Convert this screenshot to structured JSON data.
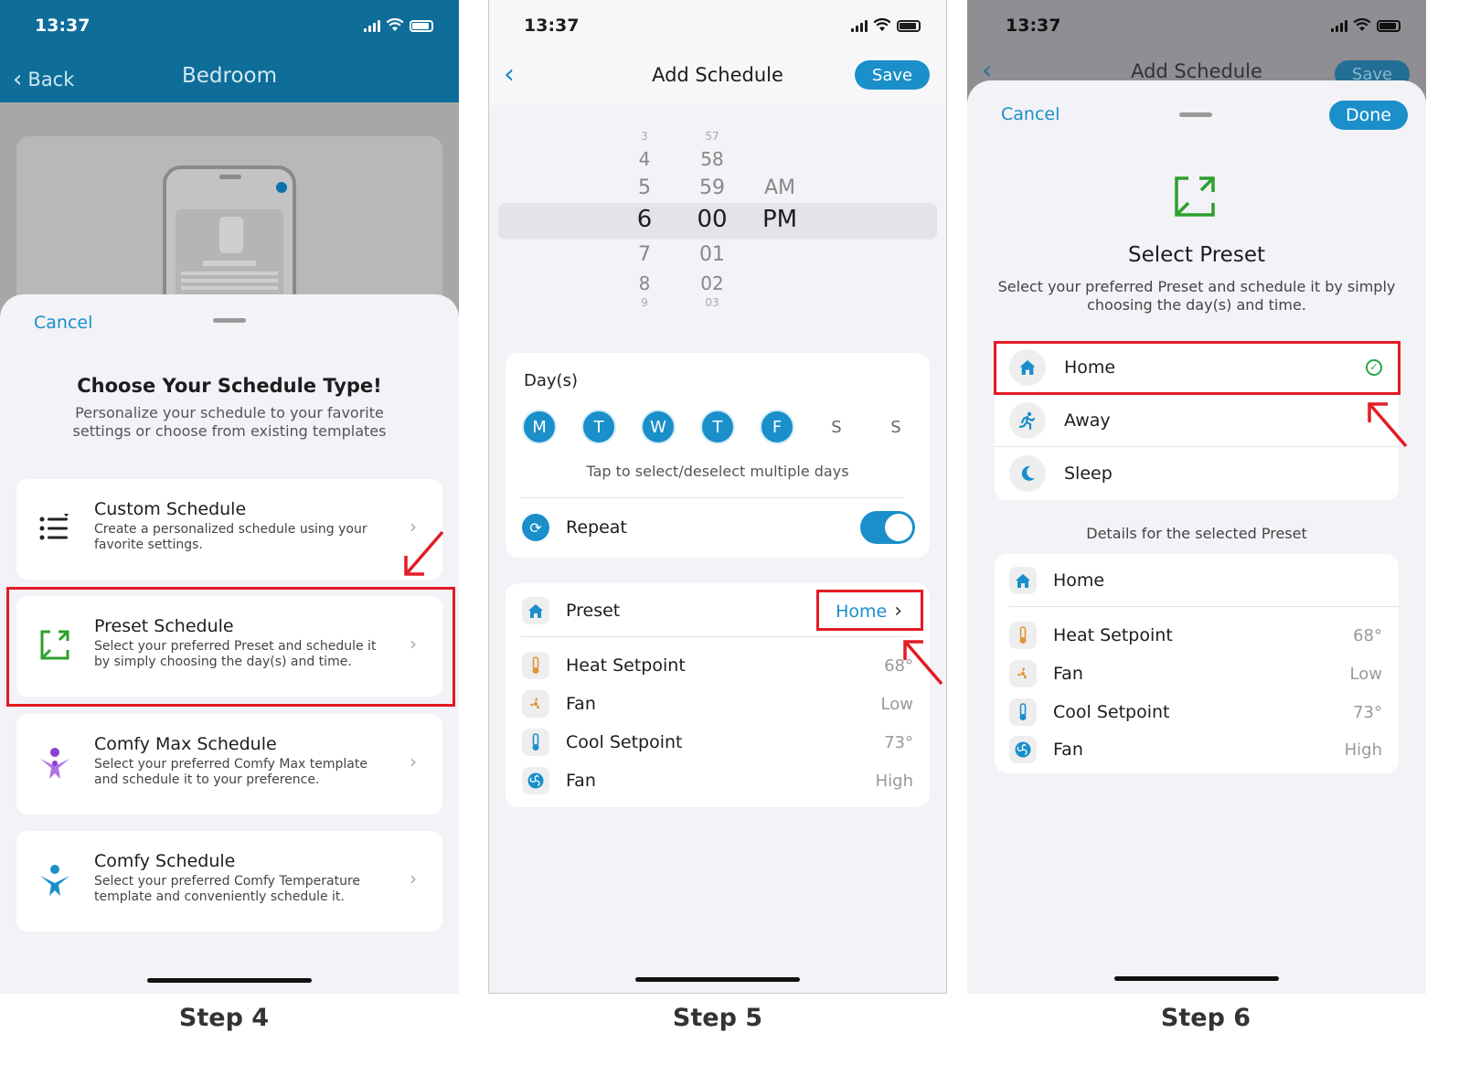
{
  "status": {
    "time": "13:37"
  },
  "step4": {
    "nav": {
      "back_label": "Back",
      "title": "Bedroom"
    },
    "sheet": {
      "cancel_label": "Cancel",
      "heading": "Choose Your Schedule Type!",
      "subheading": "Personalize your schedule to your favorite settings or choose from existing templates",
      "options": [
        {
          "title": "Custom Schedule",
          "desc": "Create a personalized schedule using your favorite settings.",
          "icon": "list-sliders-icon"
        },
        {
          "title": "Preset Schedule",
          "desc": "Select your preferred Preset and schedule it by simply choosing the day(s) and time.",
          "icon": "preset-expand-icon"
        },
        {
          "title": "Comfy Max Schedule",
          "desc": "Select your preferred Comfy Max template and schedule it to your preference.",
          "icon": "comfy-max-person-icon"
        },
        {
          "title": "Comfy Schedule",
          "desc": "Select your preferred Comfy Temperature template and conveniently schedule it.",
          "icon": "comfy-person-icon"
        }
      ]
    },
    "label": "Step 4"
  },
  "step5": {
    "nav": {
      "title": "Add Schedule",
      "save_label": "Save"
    },
    "picker": {
      "hours": [
        "3",
        "4",
        "5",
        "6",
        "7",
        "8",
        "9"
      ],
      "minutes": [
        "57",
        "58",
        "59",
        "00",
        "01",
        "02",
        "03"
      ],
      "ampm": [
        "AM",
        "PM"
      ],
      "selected": {
        "hour": "6",
        "minute": "00",
        "ampm": "PM"
      }
    },
    "days": {
      "label": "Day(s)",
      "items": [
        {
          "letter": "M",
          "selected": true
        },
        {
          "letter": "T",
          "selected": true
        },
        {
          "letter": "W",
          "selected": true
        },
        {
          "letter": "T",
          "selected": true
        },
        {
          "letter": "F",
          "selected": true
        },
        {
          "letter": "S",
          "selected": false
        },
        {
          "letter": "S",
          "selected": false
        }
      ],
      "hint": "Tap to select/deselect multiple days",
      "repeat_label": "Repeat",
      "repeat_on": true
    },
    "preset": {
      "label": "Preset",
      "value": "Home",
      "settings": [
        {
          "label": "Heat Setpoint",
          "value": "68°",
          "icon": "thermometer-heat-icon"
        },
        {
          "label": "Fan",
          "value": "Low",
          "icon": "fan-low-icon"
        },
        {
          "label": "Cool Setpoint",
          "value": "73°",
          "icon": "thermometer-cool-icon"
        },
        {
          "label": "Fan",
          "value": "High",
          "icon": "fan-high-icon"
        }
      ]
    },
    "label": "Step 5"
  },
  "step6": {
    "ghost": {
      "title": "Add Schedule",
      "save_label": "Save"
    },
    "sheet": {
      "cancel_label": "Cancel",
      "done_label": "Done",
      "heading": "Select Preset",
      "subheading": "Select your preferred Preset and schedule it by simply choosing the day(s) and time.",
      "presets": [
        {
          "name": "Home",
          "icon": "home-icon",
          "selected": true
        },
        {
          "name": "Away",
          "icon": "running-person-icon",
          "selected": false
        },
        {
          "name": "Sleep",
          "icon": "moon-icon",
          "selected": false
        }
      ],
      "details_heading": "Details for the selected Preset",
      "details": {
        "name": "Home",
        "settings": [
          {
            "label": "Heat Setpoint",
            "value": "68°"
          },
          {
            "label": "Fan",
            "value": "Low"
          },
          {
            "label": "Cool Setpoint",
            "value": "73°"
          },
          {
            "label": "Fan",
            "value": "High"
          }
        ]
      }
    },
    "label": "Step 6"
  },
  "colors": {
    "accent": "#1a8fc9",
    "nav_bg": "#0e6d99",
    "highlight": "#e31b23",
    "preset_green": "#2ca02c",
    "comfy_max_purple": "#8a3fd1"
  }
}
